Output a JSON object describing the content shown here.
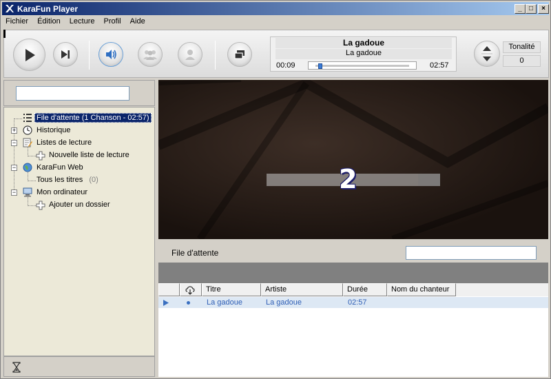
{
  "window": {
    "title": "KaraFun Player"
  },
  "menu": [
    "Fichier",
    "Édition",
    "Lecture",
    "Profil",
    "Aide"
  ],
  "now_playing": {
    "title": "La gadoue",
    "artist": "La gadoue",
    "elapsed": "00:09",
    "duration": "02:57",
    "progress_fraction": 0.05
  },
  "tone": {
    "label": "Tonalité",
    "value": "0"
  },
  "tree": {
    "queue": "File d'attente (1 Chanson - 02:57)",
    "history": "Historique",
    "playlists": "Listes de lecture",
    "new_playlist": "Nouvelle liste de lecture",
    "karafun_web": "KaraFun Web",
    "all_titles": "Tous les titres",
    "all_titles_count": "(0)",
    "my_computer": "Mon ordinateur",
    "add_folder": "Ajouter un dossier"
  },
  "video": {
    "countdown": "2"
  },
  "queue": {
    "title": "File d'attente",
    "columns": [
      "Titre",
      "Artiste",
      "Durée",
      "Nom du chanteur"
    ],
    "rows": [
      {
        "title": "La gadoue",
        "artist": "La gadoue",
        "duration": "02:57",
        "singer": ""
      }
    ]
  },
  "icons": [
    "play-icon",
    "next-icon",
    "speaker-icon",
    "group-icon",
    "user-icon",
    "screen-icon",
    "tone-up-icon",
    "tone-down-icon",
    "hourglass-icon",
    "cloud-download-icon"
  ],
  "colors": {
    "title_bar": "#0a246a",
    "selection": "#0a246a",
    "row_highlight": "#dde8f4",
    "row_text": "#2e5eb5"
  }
}
